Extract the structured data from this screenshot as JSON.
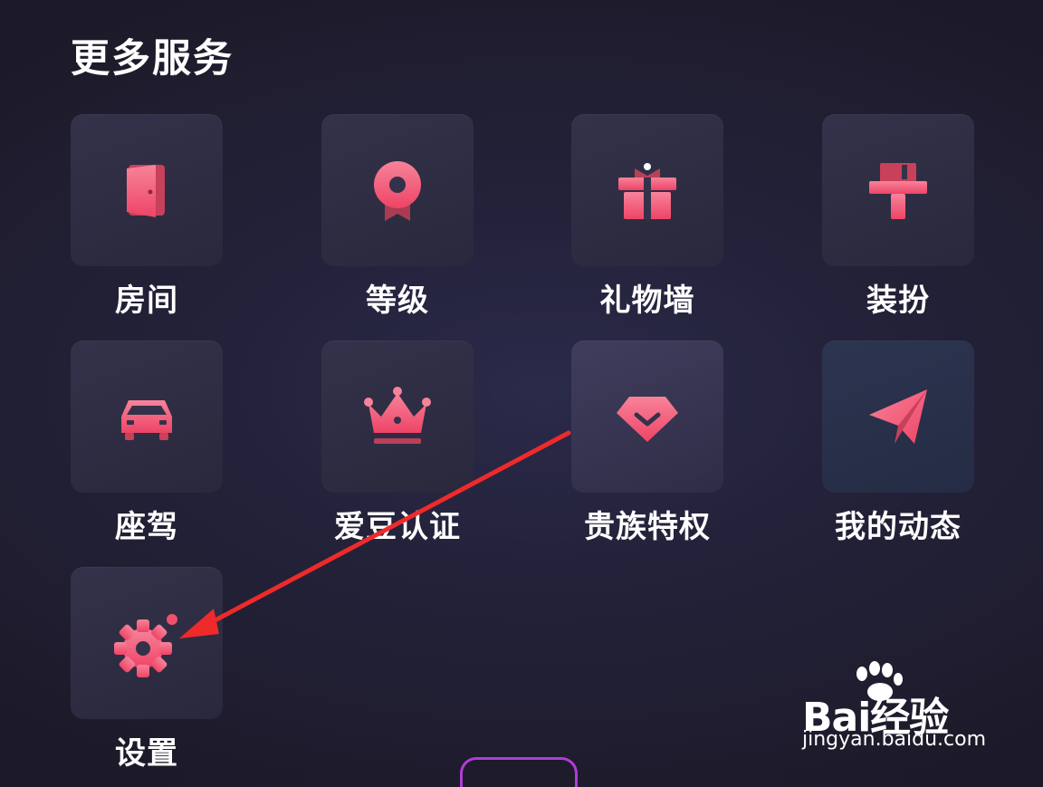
{
  "section": {
    "title": "更多服务"
  },
  "services": [
    {
      "label": "房间",
      "icon": "door-icon"
    },
    {
      "label": "等级",
      "icon": "medal-icon"
    },
    {
      "label": "礼物墙",
      "icon": "gift-icon"
    },
    {
      "label": "装扮",
      "icon": "paint-roller-icon"
    },
    {
      "label": "座驾",
      "icon": "car-icon"
    },
    {
      "label": "爱豆认证",
      "icon": "crown-icon"
    },
    {
      "label": "贵族特权",
      "icon": "diamond-icon"
    },
    {
      "label": "我的动态",
      "icon": "paper-plane-icon"
    },
    {
      "label": "设置",
      "icon": "gear-icon"
    }
  ],
  "colors": {
    "accent": "#f0506e",
    "accent_light": "#f7839a",
    "background": "#1c1a28"
  },
  "watermark": {
    "brand": "Bai经验",
    "url": "jingyan.baidu.com"
  }
}
